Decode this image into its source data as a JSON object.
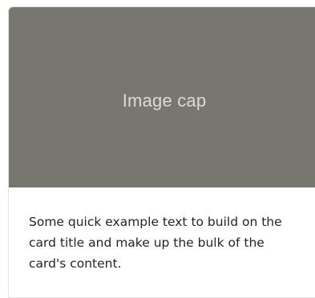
{
  "card": {
    "image_cap": "Image cap",
    "text": "Some quick example text to build on the card title and make up the bulk of the card's content.",
    "image_bg_color": "#77776f"
  }
}
